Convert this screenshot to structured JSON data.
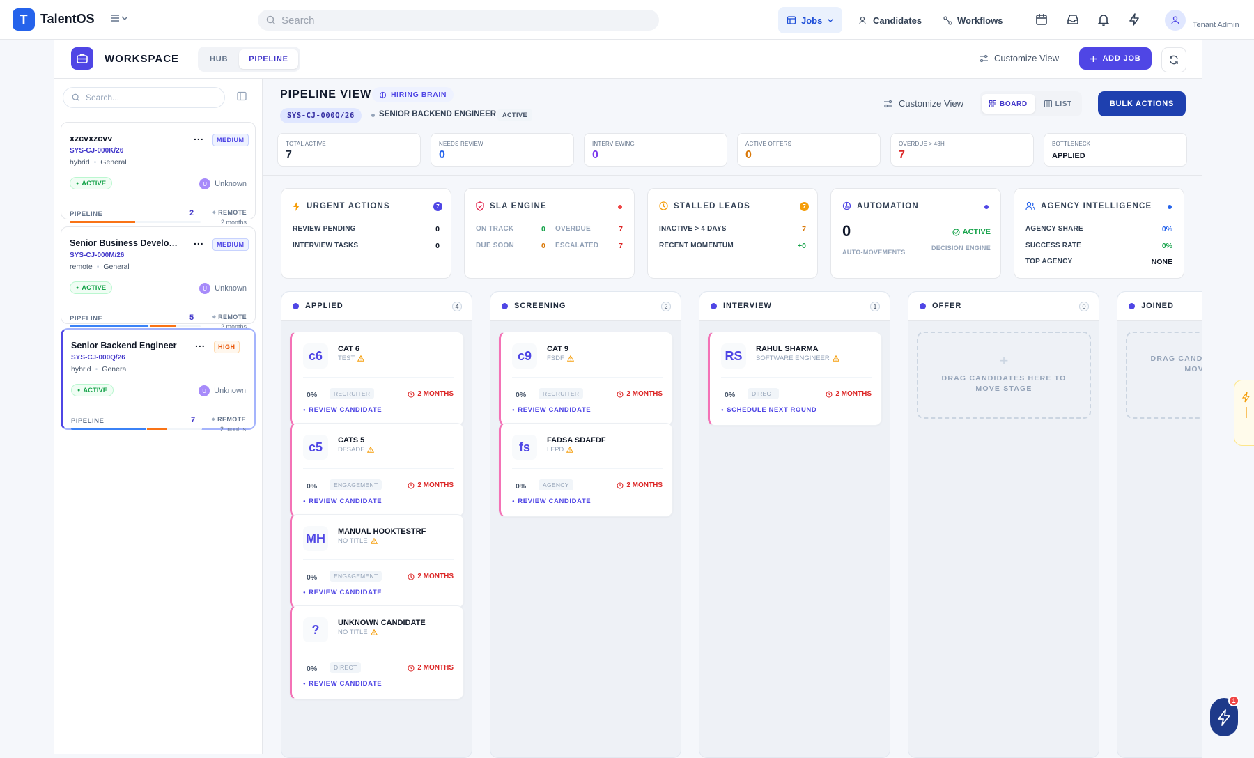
{
  "app": {
    "logo_letter": "T",
    "name": "TalentOS"
  },
  "search": {
    "placeholder": "Search"
  },
  "nav": {
    "jobs": "Jobs",
    "candidates": "Candidates",
    "workflows": "Workflows"
  },
  "user": {
    "role": "Tenant Admin"
  },
  "workspace": {
    "title": "WORKSPACE",
    "tabs": [
      "HUB",
      "PIPELINE"
    ],
    "active_tab": "PIPELINE",
    "customize": "Customize View",
    "add_job": "ADD JOB"
  },
  "sidebar": {
    "search_placeholder": "Search...",
    "jobs": [
      {
        "title": "xzcvxzcvv",
        "priority": "MEDIUM",
        "code": "SYS-CJ-000K/26",
        "mode": "hybrid",
        "dept": "General",
        "status": "ACTIVE",
        "owner_initial": "U",
        "owner": "Unknown",
        "pipeline_label": "PIPELINE",
        "pipeline_count": "2",
        "remote": "REMOTE",
        "age": "2 months",
        "progress": [
          {
            "pct": 0.5,
            "color": "#f97316"
          }
        ]
      },
      {
        "title": "Senior Business Develop...",
        "priority": "MEDIUM",
        "code": "SYS-CJ-000M/26",
        "mode": "remote",
        "dept": "General",
        "status": "ACTIVE",
        "owner_initial": "U",
        "owner": "Unknown",
        "pipeline_label": "PIPELINE",
        "pipeline_count": "5",
        "remote": "REMOTE",
        "age": "2 months",
        "progress": [
          {
            "pct": 0.6,
            "color": "#3b82f6"
          },
          {
            "pct": 0.2,
            "color": "#f97316"
          }
        ]
      },
      {
        "title": "Senior Backend Engineer",
        "priority": "HIGH",
        "code": "SYS-CJ-000Q/26",
        "mode": "hybrid",
        "dept": "General",
        "status": "ACTIVE",
        "owner_initial": "U",
        "owner": "Unknown",
        "pipeline_label": "PIPELINE",
        "pipeline_count": "7",
        "remote": "REMOTE",
        "age": "2 months",
        "progress": [
          {
            "pct": 0.57,
            "color": "#3b82f6"
          },
          {
            "pct": 0.15,
            "color": "#f97316"
          }
        ]
      }
    ]
  },
  "pipeline": {
    "title": "PIPELINE VIEW",
    "hiring_brain": "HIRING BRAIN",
    "code": "SYS-CJ-000Q/26",
    "role": "SENIOR BACKEND ENGINEER",
    "status": "ACTIVE",
    "customize": "Customize View",
    "view_board": "BOARD",
    "view_list": "LIST",
    "bulk": "BULK ACTIONS"
  },
  "stats": [
    {
      "label": "TOTAL ACTIVE",
      "value": "7",
      "color": "#1e293b"
    },
    {
      "label": "NEEDS REVIEW",
      "value": "0",
      "color": "#2563eb"
    },
    {
      "label": "INTERVIEWING",
      "value": "0",
      "color": "#7c3aed"
    },
    {
      "label": "ACTIVE OFFERS",
      "value": "0",
      "color": "#d97706"
    },
    {
      "label": "OVERDUE > 48H",
      "value": "7",
      "color": "#dc2626"
    },
    {
      "label": "BOTTLENECK",
      "value": "APPLIED",
      "color": "#111827"
    }
  ],
  "insights": {
    "urgent": {
      "title": "URGENT ACTIONS",
      "badge": "7",
      "rows": [
        {
          "label": "REVIEW PENDING",
          "value": "0"
        },
        {
          "label": "INTERVIEW TASKS",
          "value": "0"
        }
      ]
    },
    "sla": {
      "title": "SLA ENGINE",
      "on_track": "ON TRACK",
      "on_track_v": "0",
      "overdue": "OVERDUE",
      "overdue_v": "7",
      "due_soon": "DUE SOON",
      "due_soon_v": "0",
      "escalated": "ESCALATED",
      "escalated_v": "7"
    },
    "stalled": {
      "title": "STALLED LEADS",
      "badge": "7",
      "rows": [
        {
          "label": "INACTIVE > 4 DAYS",
          "value": "7"
        },
        {
          "label": "RECENT MOMENTUM",
          "value": "+0"
        }
      ]
    },
    "automation": {
      "title": "AUTOMATION",
      "count": "0",
      "count_label": "AUTO-MOVEMENTS",
      "status": "ACTIVE",
      "status_label": "DECISION ENGINE"
    },
    "agency": {
      "title": "AGENCY INTELLIGENCE",
      "rows": [
        {
          "label": "AGENCY SHARE",
          "value": "0%"
        },
        {
          "label": "SUCCESS RATE",
          "value": "0%"
        },
        {
          "label": "TOP AGENCY",
          "value": "NONE"
        }
      ]
    }
  },
  "columns": [
    {
      "name": "APPLIED",
      "count": "4",
      "cards": [
        {
          "initials": "c6",
          "name": "CAT 6",
          "role": "TEST",
          "pct": "0%",
          "source": "RECRUITER",
          "age": "2 MONTHS",
          "action": "REVIEW CANDIDATE"
        },
        {
          "initials": "c5",
          "name": "CATS 5",
          "role": "DFSADF",
          "pct": "0%",
          "source": "ENGAGEMENT",
          "age": "2 MONTHS",
          "action": "REVIEW CANDIDATE"
        },
        {
          "initials": "MH",
          "name": "MANUAL HOOKTESTRF",
          "role": "NO TITLE",
          "pct": "0%",
          "source": "ENGAGEMENT",
          "age": "2 MONTHS",
          "action": "REVIEW CANDIDATE"
        },
        {
          "initials": "?",
          "name": "UNKNOWN CANDIDATE",
          "role": "NO TITLE",
          "pct": "0%",
          "source": "DIRECT",
          "age": "2 MONTHS",
          "action": "REVIEW CANDIDATE"
        }
      ]
    },
    {
      "name": "SCREENING",
      "count": "2",
      "cards": [
        {
          "initials": "c9",
          "name": "CAT 9",
          "role": "FSDF",
          "pct": "0%",
          "source": "RECRUITER",
          "age": "2 MONTHS",
          "action": "REVIEW CANDIDATE"
        },
        {
          "initials": "fs",
          "name": "FADSA SDAFDF",
          "role": "LFPD",
          "pct": "0%",
          "source": "AGENCY",
          "age": "2 MONTHS",
          "action": "REVIEW CANDIDATE"
        }
      ]
    },
    {
      "name": "INTERVIEW",
      "count": "1",
      "cards": [
        {
          "initials": "RS",
          "name": "RAHUL SHARMA",
          "role": "SOFTWARE ENGINEER",
          "pct": "0%",
          "source": "DIRECT",
          "age": "2 MONTHS",
          "action": "SCHEDULE NEXT ROUND"
        }
      ]
    },
    {
      "name": "OFFER",
      "count": "0",
      "cards": [],
      "drop": "DRAG CANDIDATES HERE TO MOVE STAGE"
    },
    {
      "name": "JOINED",
      "count": "",
      "cards": [],
      "drop": "DRAG CANDIDATES HERE TO MOVE STAGE"
    }
  ],
  "fab": {
    "badge": "1"
  }
}
